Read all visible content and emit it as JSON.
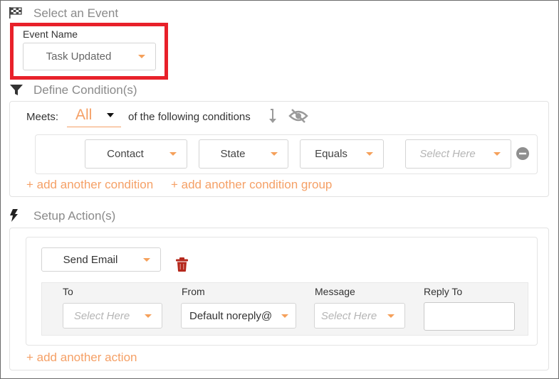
{
  "event_section": {
    "title": "Select an Event",
    "icon": "checkered-flag-icon",
    "field_label": "Event Name",
    "event_value": "Task Updated"
  },
  "condition_section": {
    "title": "Define Condition(s)",
    "icon": "filter-icon",
    "meets_label": "Meets:",
    "meets_value": "All",
    "following_text": "of the following conditions",
    "row": {
      "field1": "Contact",
      "field2": "State",
      "operator": "Equals",
      "value_placeholder": "Select Here"
    },
    "add_condition": "+ add another condition",
    "add_group": "+ add another condition group"
  },
  "action_section": {
    "title": "Setup Action(s)",
    "icon": "lightning-icon",
    "action_value": "Send Email",
    "columns": {
      "to": "To",
      "from": "From",
      "message": "Message",
      "reply_to": "Reply To"
    },
    "to_placeholder": "Select Here",
    "from_value": "Default noreply@",
    "message_placeholder": "Select Here",
    "reply_to_value": "",
    "add_action": "+ add another action"
  },
  "colors": {
    "accent_orange": "#f5a066",
    "highlight_red": "#e8212a",
    "trash_red": "#b5281c"
  }
}
